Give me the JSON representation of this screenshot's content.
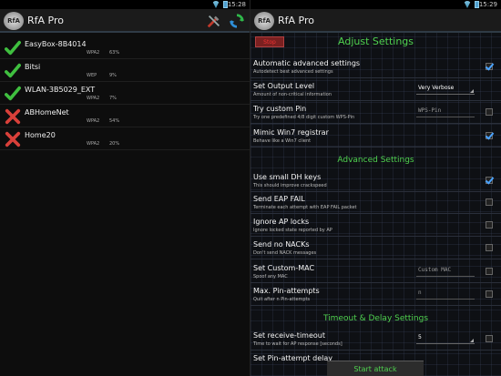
{
  "left": {
    "status_time": "15:28",
    "app_title": "RfA Pro",
    "logo_text": "RfA",
    "networks": [
      {
        "name": "EasyBox-8B4014",
        "security": "WPA2",
        "signal": "63%",
        "state": "ok"
      },
      {
        "name": "Bitsi",
        "security": "WEP",
        "signal": "9%",
        "state": "ok"
      },
      {
        "name": "WLAN-3B5029_EXT",
        "security": "WPA2",
        "signal": "7%",
        "state": "ok"
      },
      {
        "name": "ABHomeNet",
        "security": "WPA2",
        "signal": "54%",
        "state": "fail"
      },
      {
        "name": "Home20",
        "security": "WPA2",
        "signal": "20%",
        "state": "fail"
      }
    ]
  },
  "right": {
    "status_time": "15:29",
    "app_title": "RfA Pro",
    "logo_text": "RfA",
    "stop_label": "Stop",
    "title": "Adjust Settings",
    "section_advanced": "Advanced Settings",
    "section_timeout": "Timeout & Delay Settings",
    "start_label": "Start attack",
    "settings": {
      "auto_adv": {
        "title": "Automatic advanced settings",
        "sub": "Autodetect best advanced settings",
        "checked": true
      },
      "output_level": {
        "title": "Set Output Level",
        "sub": "Amount of non-critical information",
        "value": "Very Verbose"
      },
      "custom_pin": {
        "title": "Try custom Pin",
        "sub": "Try one predefined 4/8 digit custom WPS-Pin",
        "placeholder": "WPS-Pin",
        "checked": false
      },
      "mimic_win7": {
        "title": "Mimic Win7 registrar",
        "sub": "Behave like a Win7 client",
        "checked": true
      },
      "small_dh": {
        "title": "Use small DH keys",
        "sub": "This should improve crackspeed",
        "checked": true
      },
      "eap_fail": {
        "title": "Send EAP FAIL",
        "sub": "Terminate each attempt with EAP FAIL packet",
        "checked": false
      },
      "ignore_locks": {
        "title": "Ignore AP locks",
        "sub": "Ignore locked state reported by AP",
        "checked": false
      },
      "no_nacks": {
        "title": "Send no NACKs",
        "sub": "Don't send NACK messages",
        "checked": false
      },
      "custom_mac": {
        "title": "Set Custom-MAC",
        "sub": "Spoof any MAC",
        "placeholder": "Custom MAC",
        "checked": false
      },
      "max_pin": {
        "title": "Max. Pin-attempts",
        "sub": "Quit after n Pin-attempts",
        "placeholder": "n",
        "checked": false
      },
      "recv_timeout": {
        "title": "Set receive-timeout",
        "sub": "Time to wait for AP response [seconds]",
        "value": "5",
        "checked": false
      },
      "pin_delay": {
        "title": "Set Pin-attempt delay"
      }
    }
  },
  "colors": {
    "accent_green": "#4fd14f",
    "check_blue": "#4aa3ff",
    "fail_red": "#d9403a",
    "ok_green": "#3fbf3f"
  },
  "icons": [
    "wifi-icon",
    "battery-icon",
    "tools-icon",
    "refresh-icon",
    "checkmark-icon",
    "cross-icon"
  ]
}
